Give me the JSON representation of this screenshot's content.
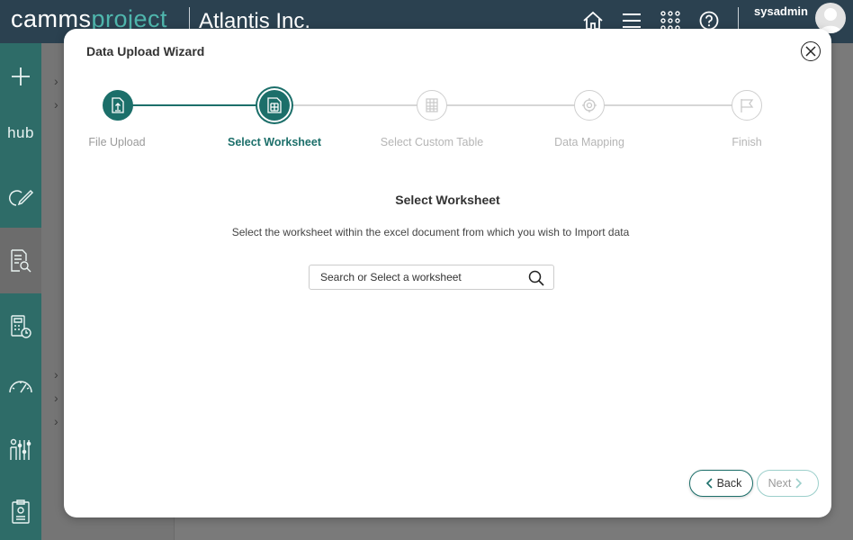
{
  "header": {
    "logo_part1": "camms",
    "logo_part2": "project",
    "org_name": "Atlantis Inc.",
    "username": "sysadmin",
    "icons": [
      "home-icon",
      "menu-icon",
      "apps-grid-icon",
      "help-icon"
    ]
  },
  "sidebar": {
    "items": [
      {
        "icon": "plus-icon"
      },
      {
        "icon": "hub-icon",
        "label": "hub"
      },
      {
        "icon": "edit-icon"
      },
      {
        "icon": "document-search-icon"
      },
      {
        "icon": "calculator-clock-icon"
      },
      {
        "icon": "gauge-icon"
      },
      {
        "icon": "people-chart-icon"
      },
      {
        "icon": "report-icon"
      }
    ]
  },
  "modal": {
    "title": "Data Upload Wizard",
    "steps": [
      {
        "label": "File Upload",
        "state": "done"
      },
      {
        "label": "Select Worksheet",
        "state": "active"
      },
      {
        "label": "Select Custom Table",
        "state": "pending"
      },
      {
        "label": "Data Mapping",
        "state": "pending"
      },
      {
        "label": "Finish",
        "state": "pending"
      }
    ],
    "section_title": "Select Worksheet",
    "instruction": "Select the worksheet within the excel document from which you wish to Import data",
    "worksheet_placeholder": "Search or Select a worksheet",
    "back_label": "Back",
    "next_label": "Next"
  },
  "colors": {
    "topbar": "#2b4150",
    "accent": "#1c6f6a",
    "logo_accent": "#4fb6ad",
    "sidebar": "#2e6c68"
  }
}
